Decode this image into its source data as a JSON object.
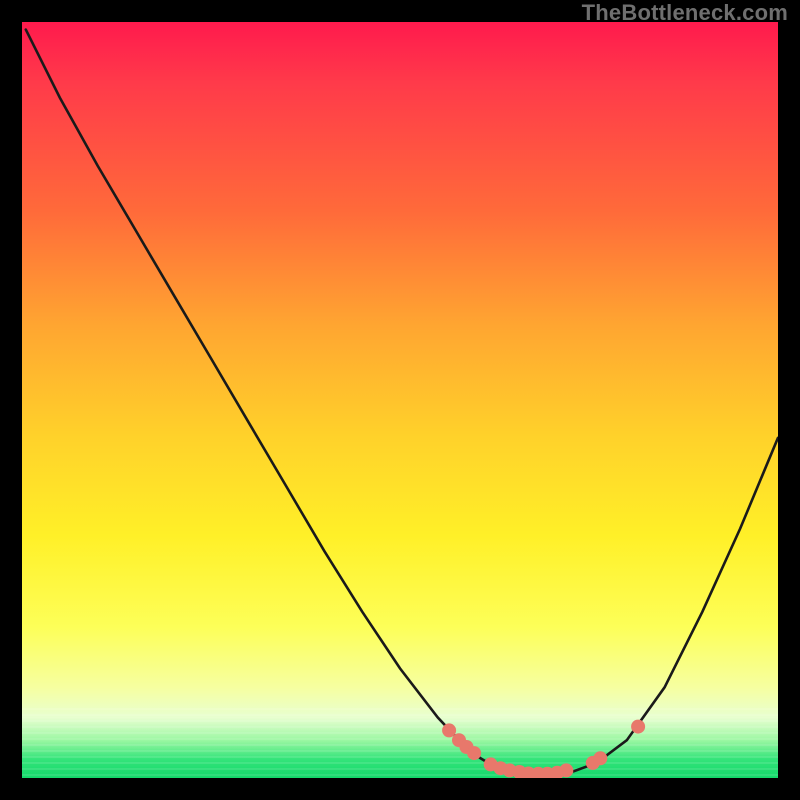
{
  "watermark": "TheBottleneck.com",
  "colors": {
    "background": "#000000",
    "gradient_top": "#ff1a4d",
    "gradient_mid": "#ffd22a",
    "gradient_bottom": "#13d86a",
    "curve": "#1a1a1a",
    "dot": "#e8786b"
  },
  "chart_data": {
    "type": "line",
    "title": "",
    "xlabel": "",
    "ylabel": "",
    "xlim": [
      0,
      100
    ],
    "ylim": [
      0,
      100
    ],
    "note": "Axes are not labeled in the image. x and y normalized to 0–100 of the plot area; y=0 is the bottom (green) edge, y=100 is the top (red) edge.",
    "series": [
      {
        "name": "curve",
        "x": [
          0.5,
          5,
          10,
          15,
          20,
          25,
          30,
          35,
          40,
          45,
          50,
          55,
          58,
          60,
          62,
          65,
          68,
          70,
          73,
          76,
          80,
          85,
          90,
          95,
          100
        ],
        "y": [
          99,
          90,
          81,
          72.5,
          64,
          55.5,
          47,
          38.5,
          30,
          22,
          14.5,
          8,
          4.8,
          3,
          1.8,
          0.9,
          0.5,
          0.5,
          0.9,
          2,
          5,
          12,
          22,
          33,
          45
        ]
      }
    ],
    "markers": {
      "name": "dots-on-curve",
      "x": [
        56.5,
        57.8,
        58.8,
        59.8,
        62.0,
        63.3,
        64.5,
        65.8,
        67.0,
        68.3,
        69.5,
        70.8,
        72.0,
        75.5,
        76.5,
        81.5
      ],
      "y": [
        6.3,
        5.0,
        4.1,
        3.3,
        1.8,
        1.3,
        1.0,
        0.8,
        0.6,
        0.55,
        0.55,
        0.7,
        1.0,
        2.0,
        2.6,
        6.8
      ]
    }
  }
}
